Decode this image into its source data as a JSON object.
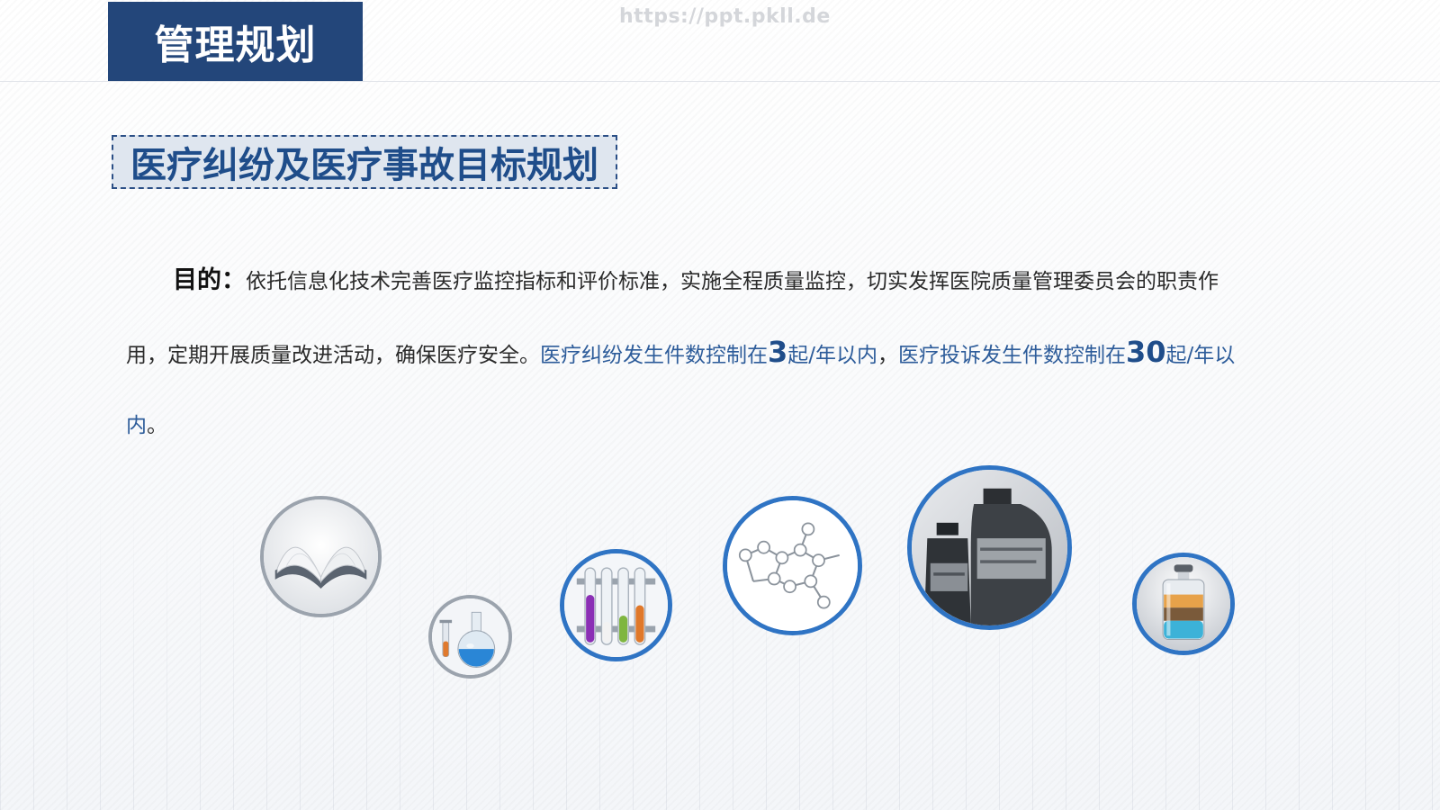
{
  "header": {
    "title": "管理规划"
  },
  "watermark": "https://ppt.pkll.de",
  "section": {
    "title": "医疗纠纷及医疗事故目标规划"
  },
  "body": {
    "label": "目的：",
    "text1": "依托信息化技术完善医疗监控指标和评价标准，实施全程质量监控，切实发挥医院质量管理委员会的职责作用，定期开展质量改进活动，确保医疗安全。",
    "hl1": "医疗纠纷发生件数控制在",
    "num1": "3",
    "hl2": "起/年以内",
    "sep": "，",
    "hl3": "医疗投诉发生件数控制在",
    "num2": "30",
    "hl4": "起/年以内",
    "end": "。"
  },
  "images": [
    {
      "name": "open-book-icon"
    },
    {
      "name": "flask-icon"
    },
    {
      "name": "test-tubes-icon"
    },
    {
      "name": "molecule-icon"
    },
    {
      "name": "medicine-bottles-icon"
    },
    {
      "name": "layered-vial-icon"
    }
  ],
  "colors": {
    "primary": "#23467a",
    "accent": "#2f74c4",
    "highlight": "#2d5c9a"
  }
}
